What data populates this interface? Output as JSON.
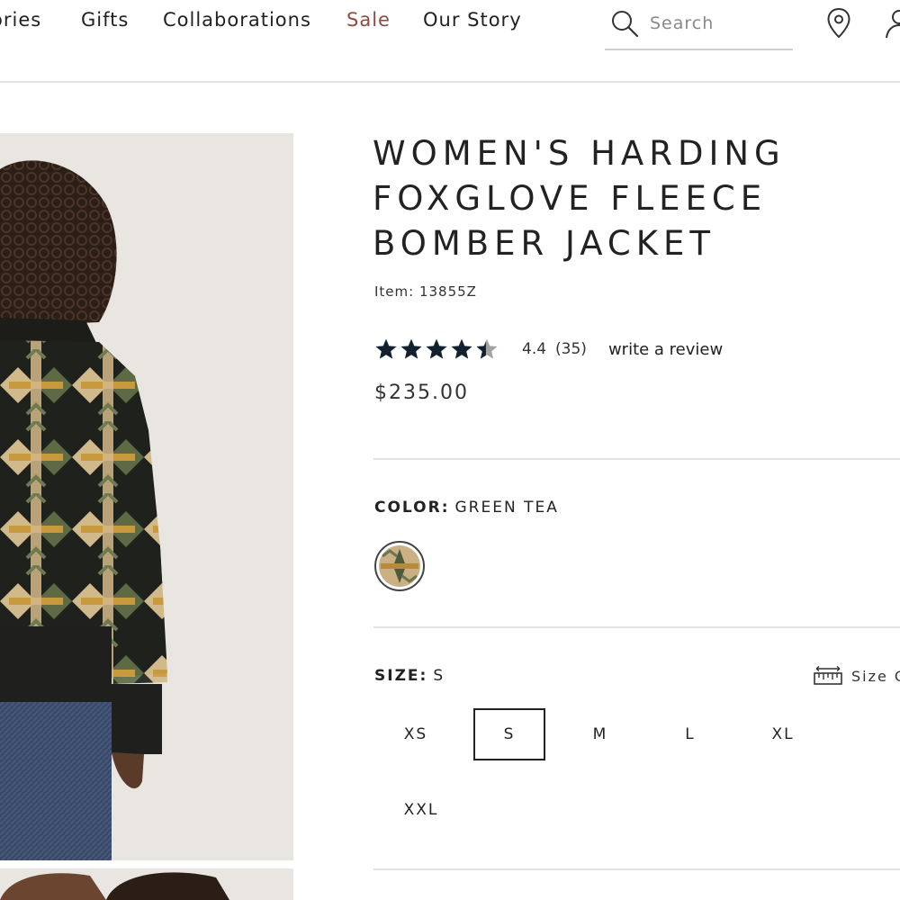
{
  "nav": {
    "items": [
      "ories",
      "Gifts",
      "Collaborations",
      "Sale",
      "Our Story"
    ],
    "sale_color": "#8e4b3e"
  },
  "search": {
    "placeholder": "Search",
    "value": ""
  },
  "header_icons": [
    "search-icon",
    "location-pin-icon",
    "account-icon"
  ],
  "product": {
    "title": "WOMEN'S HARDING FOXGLOVE FLEECE BOMBER JACKET",
    "item_number": "Item: 13855Z",
    "rating": {
      "stars": 4.4,
      "value": "4.4",
      "count": "(35)",
      "write_review": "write a review"
    },
    "price": "$235.00",
    "color": {
      "label": "COLOR:",
      "selected": "GREEN TEA"
    },
    "size": {
      "label": "SIZE:",
      "selected": "S",
      "guide_label": "Size G",
      "options": [
        "XS",
        "S",
        "M",
        "L",
        "XL",
        "XXL"
      ]
    }
  },
  "colors": {
    "text": "#222222",
    "divider": "#e3e3e3",
    "star_fill": "#13202e",
    "image_bg": "#e9e6e1"
  }
}
